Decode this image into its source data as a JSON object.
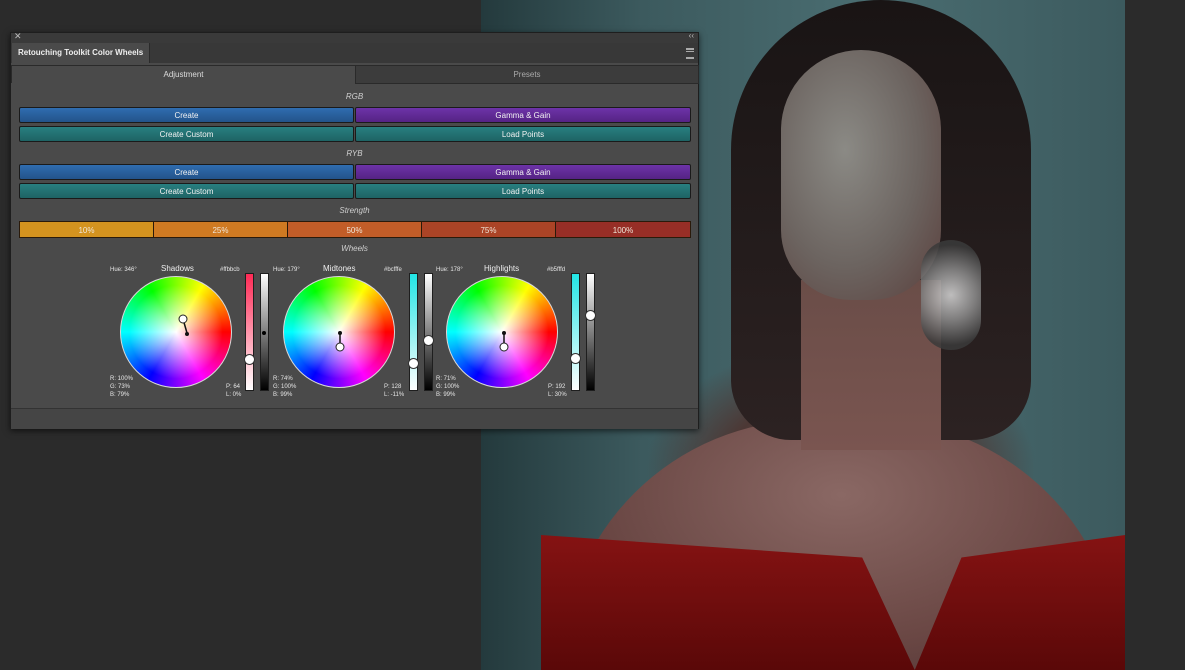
{
  "panel": {
    "close_glyph": "✕",
    "collapse_glyph": "‹‹",
    "title": "Retouching Toolkit Color Wheels",
    "tabs": [
      "Adjustment",
      "Presets"
    ]
  },
  "rgb": {
    "heading": "RGB",
    "create": "Create",
    "gamma_gain": "Gamma & Gain",
    "create_custom": "Create Custom",
    "load_points": "Load Points"
  },
  "ryb": {
    "heading": "RYB",
    "create": "Create",
    "gamma_gain": "Gamma & Gain",
    "create_custom": "Create Custom",
    "load_points": "Load Points"
  },
  "strength": {
    "heading": "Strength",
    "options": [
      "10%",
      "25%",
      "50%",
      "75%",
      "100%"
    ],
    "colors": [
      "#d4931f",
      "#cf7a22",
      "#c25d28",
      "#ab4426",
      "#972e26"
    ]
  },
  "wheels": {
    "heading": "Wheels",
    "items": [
      {
        "name": "Shadows",
        "hue": "Hue: 346°",
        "hex": "#ffbbcb",
        "r": "R: 100%",
        "g": "G: 73%",
        "b": "B: 79%",
        "p": "P: 64",
        "l": "L: 0%",
        "color_slider_top": "#ff2a55",
        "color_level": 0.72,
        "lum_level": 0.5
      },
      {
        "name": "Midtones",
        "hue": "Hue: 179°",
        "hex": "#bcfffe",
        "r": "R: 74%",
        "g": "G: 100%",
        "b": "B: 99%",
        "p": "P: 128",
        "l": "L: -11%",
        "color_slider_top": "#22e5e5",
        "color_level": 0.75,
        "lum_level": 0.56
      },
      {
        "name": "Highlights",
        "hue": "Hue: 178°",
        "hex": "#b5fffd",
        "r": "R: 71%",
        "g": "G: 100%",
        "b": "B: 99%",
        "p": "P: 192",
        "l": "L: 30%",
        "color_slider_top": "#22e5e5",
        "color_level": 0.71,
        "lum_level": 0.35
      }
    ]
  }
}
